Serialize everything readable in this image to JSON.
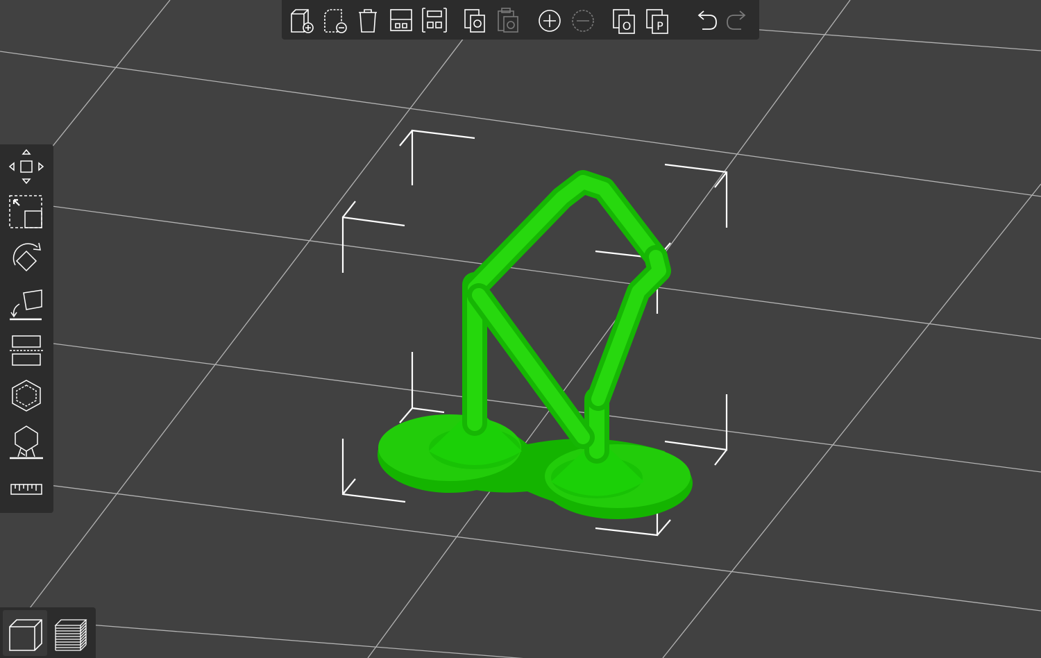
{
  "app": {
    "background_color": "#414141",
    "panel_color": "#2c2c2c",
    "icon_color": "#ffffff",
    "model_color": "#1fd80c"
  },
  "top_toolbar": {
    "items": [
      {
        "name": "add-object-icon",
        "enabled": true
      },
      {
        "name": "remove-object-icon",
        "enabled": true
      },
      {
        "name": "delete-all-icon",
        "enabled": true
      },
      {
        "name": "arrange-icon",
        "enabled": true
      },
      {
        "name": "arrange-selection-icon",
        "enabled": true
      },
      {
        "name": "copy-icon",
        "enabled": true
      },
      {
        "name": "paste-icon",
        "enabled": false
      },
      {
        "name": "add-instance-icon",
        "enabled": true
      },
      {
        "name": "remove-instance-icon",
        "enabled": false
      },
      {
        "name": "split-to-objects-icon",
        "enabled": true
      },
      {
        "name": "split-to-parts-icon",
        "enabled": true
      },
      {
        "name": "undo-icon",
        "enabled": true
      },
      {
        "name": "redo-icon",
        "enabled": false
      }
    ],
    "split_objects_letter": "O",
    "split_parts_letter": "P"
  },
  "left_toolbar": {
    "items": [
      {
        "name": "move-tool-icon"
      },
      {
        "name": "scale-tool-icon"
      },
      {
        "name": "rotate-tool-icon"
      },
      {
        "name": "place-on-face-icon"
      },
      {
        "name": "cut-tool-icon"
      },
      {
        "name": "hollow-tool-icon"
      },
      {
        "name": "support-points-icon"
      },
      {
        "name": "measure-tool-icon"
      }
    ]
  },
  "view_switch": {
    "items": [
      {
        "name": "3d-view-icon",
        "active": true
      },
      {
        "name": "preview-layers-icon",
        "active": false
      }
    ]
  }
}
